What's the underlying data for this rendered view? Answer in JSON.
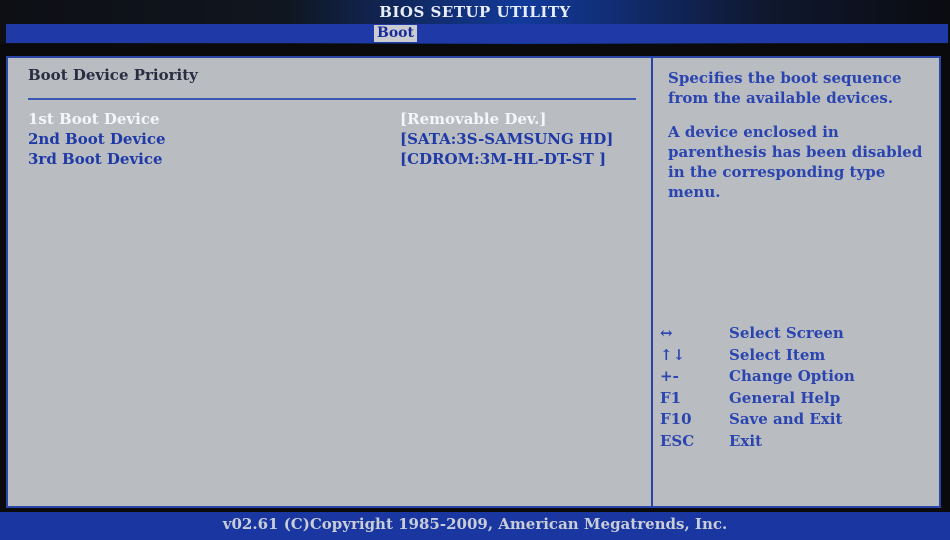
{
  "header": {
    "title": "BIOS SETUP UTILITY",
    "tabs": [
      {
        "label": "Boot",
        "active": true
      }
    ]
  },
  "main": {
    "section_title": "Boot Device Priority",
    "devices": [
      {
        "label": "1st Boot Device",
        "value": "[Removable Dev.]",
        "selected": true
      },
      {
        "label": "2nd Boot Device",
        "value": "[SATA:3S-SAMSUNG HD]",
        "selected": false
      },
      {
        "label": "3rd Boot Device",
        "value": "[CDROM:3M-HL-DT-ST ]",
        "selected": false
      }
    ]
  },
  "help": {
    "paragraphs": [
      "Specifies the boot sequence from the available devices.",
      "A device enclosed in parenthesis has been disabled in the corresponding type menu."
    ],
    "keys": [
      {
        "key": "↔",
        "action": "Select Screen",
        "icon": "left-right-arrow-icon"
      },
      {
        "key": "↑↓",
        "action": "Select Item",
        "icon": "up-down-arrow-icon"
      },
      {
        "key": "+-",
        "action": "Change Option",
        "icon": "plus-minus-icon"
      },
      {
        "key": "F1",
        "action": "General Help"
      },
      {
        "key": "F10",
        "action": "Save and Exit"
      },
      {
        "key": "ESC",
        "action": "Exit"
      }
    ]
  },
  "footer": {
    "text": "v02.61 (C)Copyright 1985-2009, American Megatrends, Inc."
  },
  "colors": {
    "accent": "#1f3aa6",
    "panel": "#b9bcc1",
    "selected_text": "#f4f6fb",
    "help_text": "#2a44b0"
  }
}
